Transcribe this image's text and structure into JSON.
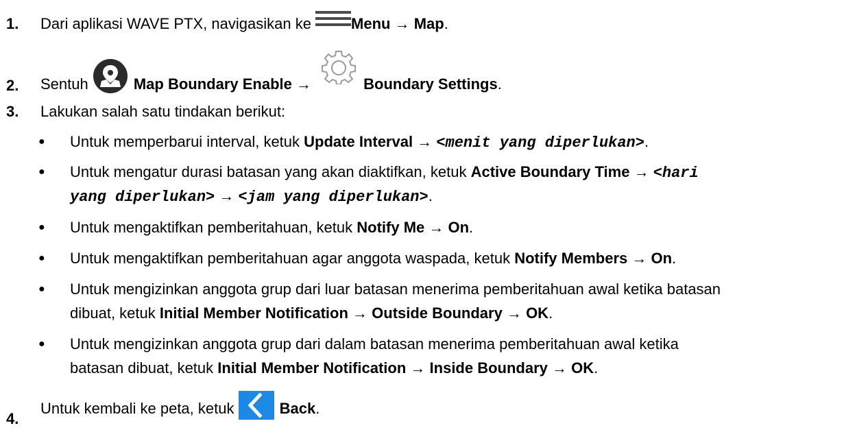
{
  "steps": [
    {
      "num": "1.",
      "text1": "Dari aplikasi WAVE PTX, navigasikan ke ",
      "bold1": "Menu",
      "arrow": " → ",
      "bold2": "Map",
      "end": ".",
      "icon": "hamburger-menu-icon"
    },
    {
      "num": "2.",
      "text1": "Sentuh ",
      "bold1": "Map Boundary Enable",
      "arrow": " → ",
      "bold2": "Boundary Settings",
      "end": ".",
      "icons": [
        "map-pin-icon",
        "gear-icon"
      ]
    },
    {
      "num": "3.",
      "text": "Lakukan salah satu tindakan berikut:"
    },
    {
      "num": "4.",
      "text1": "Untuk kembali ke peta, ketuk ",
      "bold1": "Back",
      "end": ".",
      "icon": "back-chevron-icon"
    }
  ],
  "bullets": {
    "b1": {
      "text": "Untuk memperbarui interval, ketuk ",
      "bold": "Update Interval",
      "arrow": " → ",
      "mono": "<menit yang diperlukan>",
      "end": "."
    },
    "b2": {
      "text": "Untuk mengatur durasi batasan yang akan diaktifkan, ketuk ",
      "bold": "Active Boundary Time",
      "arrow": " → ",
      "mono1": "<hari",
      "mono2": "yang diperlukan>",
      "arrow2": " → ",
      "mono3": "<jam yang diperlukan>",
      "end": "."
    },
    "b3": {
      "text": "Untuk mengaktifkan pemberitahuan, ketuk ",
      "bold1": "Notify Me",
      "arrow": " → ",
      "bold2": "On",
      "end": "."
    },
    "b4": {
      "text": "Untuk mengaktifkan pemberitahuan agar anggota waspada, ketuk ",
      "bold1": "Notify Members",
      "arrow": " → ",
      "bold2": "On",
      "end": "."
    },
    "b5": {
      "line1": "Untuk mengizinkan anggota grup dari luar batasan menerima pemberitahuan awal ketika batasan",
      "line2": "dibuat, ketuk ",
      "bold1": "Initial Member Notification",
      "arrow1": " → ",
      "bold2": "Outside Boundary",
      "arrow2": " → ",
      "bold3": "OK",
      "end": "."
    },
    "b6": {
      "line1": "Untuk mengizinkan anggota grup dari dalam batasan menerima pemberitahuan awal ketika",
      "line2": "batasan dibuat, ketuk ",
      "bold1": "Initial Member Notification",
      "arrow1": " → ",
      "bold2": "Inside Boundary",
      "arrow2": " → ",
      "bold3": "OK",
      "end": "."
    },
    "bullet_char": "●"
  },
  "colors": {
    "text": "#000000",
    "icon_dark": "#2b2b2b",
    "back_button": "#1e88e5",
    "gear_stroke": "#9a9a9a"
  }
}
